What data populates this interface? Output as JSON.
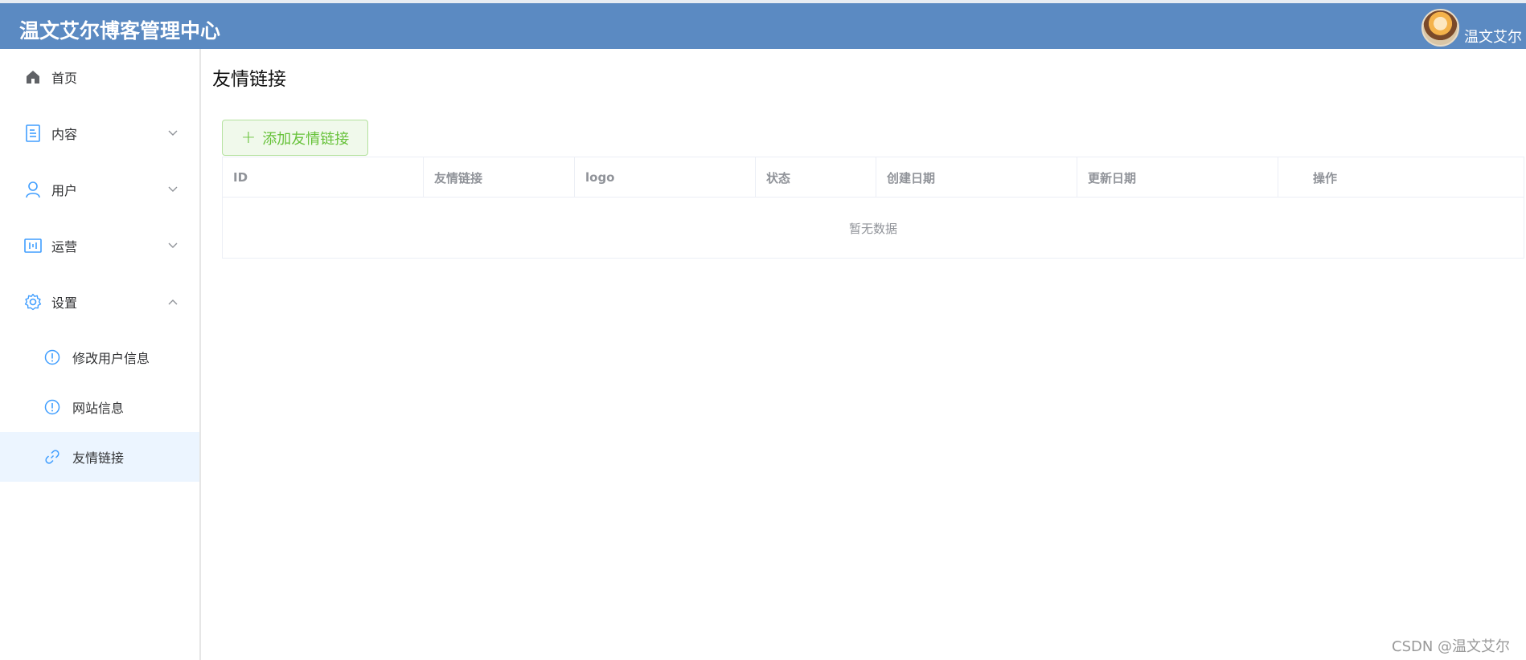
{
  "header": {
    "title": "温文艾尔博客管理中心",
    "user_name": "温文艾尔"
  },
  "sidebar": {
    "items": [
      {
        "label": "首页",
        "icon": "home-icon"
      },
      {
        "label": "内容",
        "icon": "document-icon",
        "expandable": true,
        "expanded": false
      },
      {
        "label": "用户",
        "icon": "user-icon",
        "expandable": true,
        "expanded": false
      },
      {
        "label": "运营",
        "icon": "operations-icon",
        "expandable": true,
        "expanded": false
      },
      {
        "label": "设置",
        "icon": "gear-icon",
        "expandable": true,
        "expanded": true
      }
    ],
    "sub_items": [
      {
        "label": "修改用户信息",
        "icon": "info-icon"
      },
      {
        "label": "网站信息",
        "icon": "info-icon"
      },
      {
        "label": "友情链接",
        "icon": "link-icon",
        "active": true
      }
    ]
  },
  "main": {
    "page_title": "友情链接",
    "add_button_label": "添加友情链接",
    "table": {
      "columns": [
        "ID",
        "友情链接",
        "logo",
        "状态",
        "创建日期",
        "更新日期",
        "操作"
      ],
      "rows": [],
      "empty_text": "暂无数据"
    }
  },
  "watermark": "CSDN @温文艾尔",
  "colors": {
    "header_bg": "#5b8ac2",
    "accent": "#409eff",
    "success": "#67c23a",
    "active_bg": "#ecf5ff"
  }
}
